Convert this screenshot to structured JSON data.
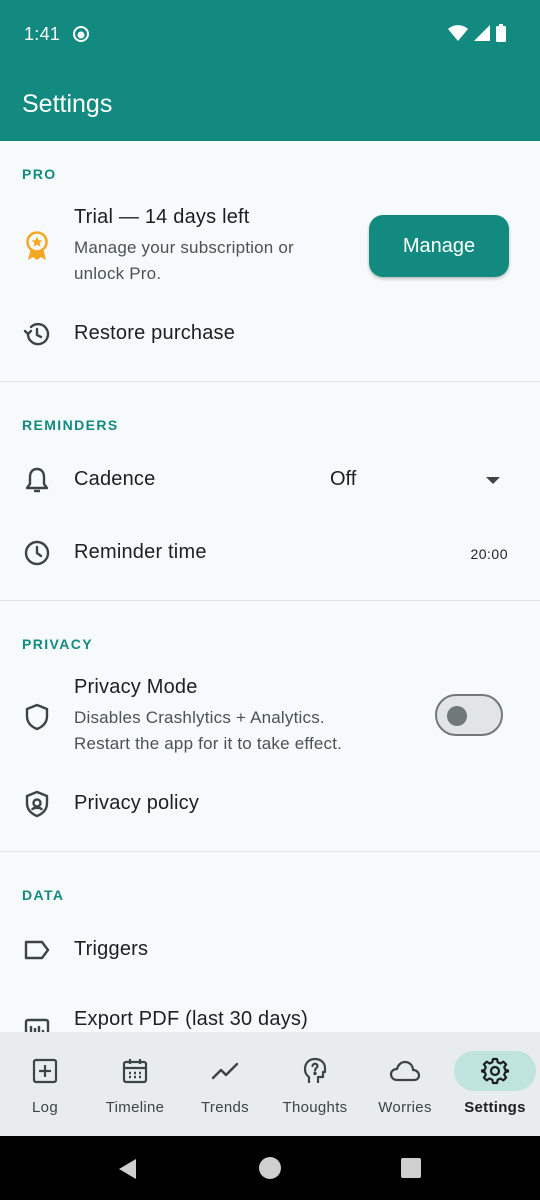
{
  "status_bar": {
    "time": "1:41"
  },
  "app_bar": {
    "title": "Settings"
  },
  "sections": {
    "pro": {
      "header": "PRO",
      "trial_title": "Trial — 14 days left",
      "trial_sub": "Manage your subscription or unlock Pro.",
      "manage_label": "Manage",
      "restore_label": "Restore purchase"
    },
    "reminders": {
      "header": "REMINDERS",
      "cadence_label": "Cadence",
      "cadence_value": "Off",
      "time_label": "Reminder time",
      "time_value": "20:00"
    },
    "privacy": {
      "header": "PRIVACY",
      "mode_title": "Privacy Mode",
      "mode_sub": "Disables Crashlytics + Analytics. Restart the app for it to take effect.",
      "mode_enabled": false,
      "policy_label": "Privacy policy"
    },
    "data": {
      "header": "DATA",
      "triggers_label": "Triggers",
      "export_label": "Export PDF (last 30 days)"
    }
  },
  "bottom_nav": {
    "items": [
      {
        "label": "Log",
        "icon": "add-box-icon"
      },
      {
        "label": "Timeline",
        "icon": "calendar-icon"
      },
      {
        "label": "Trends",
        "icon": "trend-line-icon"
      },
      {
        "label": "Thoughts",
        "icon": "psychology-icon"
      },
      {
        "label": "Worries",
        "icon": "cloud-icon"
      },
      {
        "label": "Settings",
        "icon": "gear-icon"
      }
    ],
    "active": "Settings"
  },
  "colors": {
    "primary": "#128a80",
    "active_pill": "#bfe3dd",
    "award": "#f5a623"
  }
}
